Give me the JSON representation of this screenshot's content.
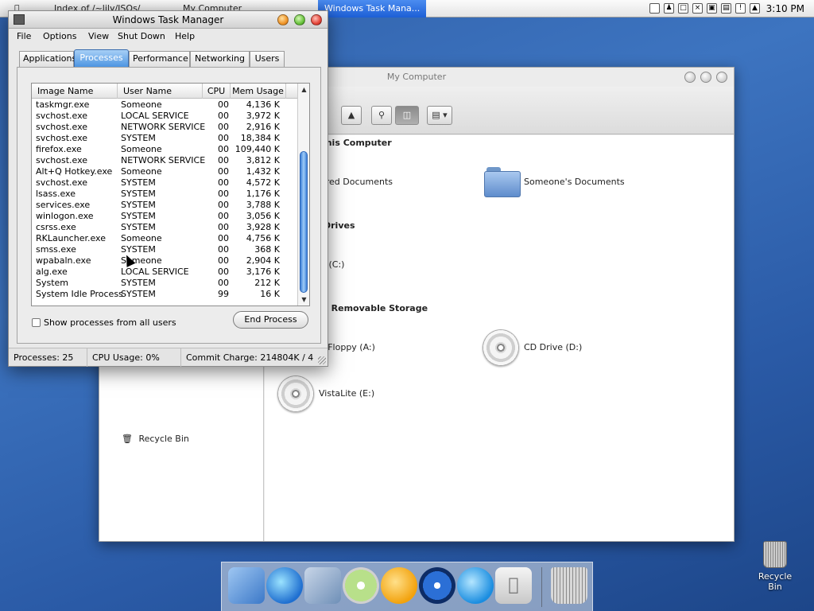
{
  "menubar": {
    "tasks": [
      "Index of /~lily/ISOs/",
      "My Computer"
    ],
    "active_task": "Windows Task Mana...",
    "clock": "3:10 PM"
  },
  "mycomputer": {
    "title": "My Computer",
    "sections": {
      "on_this_computer": "on This Computer",
      "drives": "Drives",
      "removable": "n Removable Storage"
    },
    "items": {
      "shared_docs": "ared Documents",
      "someones_docs": "Someone's Documents",
      "local_disk": "S (C:)",
      "floppy": "s Floppy (A:)",
      "cd_drive": "CD Drive (D:)",
      "vistalite": "VistaLite (E:)"
    },
    "sidebar_recycle": "Recycle Bin"
  },
  "taskmanager": {
    "title": "Windows Task Manager",
    "menu": [
      "File",
      "Options",
      "View",
      "Shut Down",
      "Help"
    ],
    "tabs": [
      "Applications",
      "Processes",
      "Performance",
      "Networking",
      "Users"
    ],
    "active_tab": "Processes",
    "columns": [
      "Image Name",
      "User Name",
      "CPU",
      "Mem Usage"
    ],
    "processes": [
      [
        "taskmgr.exe",
        "Someone",
        "00",
        "4,136 K"
      ],
      [
        "svchost.exe",
        "LOCAL SERVICE",
        "00",
        "3,972 K"
      ],
      [
        "svchost.exe",
        "NETWORK SERVICE",
        "00",
        "2,916 K"
      ],
      [
        "svchost.exe",
        "SYSTEM",
        "00",
        "18,384 K"
      ],
      [
        "firefox.exe",
        "Someone",
        "00",
        "109,440 K"
      ],
      [
        "svchost.exe",
        "NETWORK SERVICE",
        "00",
        "3,812 K"
      ],
      [
        "Alt+Q Hotkey.exe",
        "Someone",
        "00",
        "1,432 K"
      ],
      [
        "svchost.exe",
        "SYSTEM",
        "00",
        "4,572 K"
      ],
      [
        "lsass.exe",
        "SYSTEM",
        "00",
        "1,176 K"
      ],
      [
        "services.exe",
        "SYSTEM",
        "00",
        "3,788 K"
      ],
      [
        "winlogon.exe",
        "SYSTEM",
        "00",
        "3,056 K"
      ],
      [
        "csrss.exe",
        "SYSTEM",
        "00",
        "3,928 K"
      ],
      [
        "RKLauncher.exe",
        "Someone",
        "00",
        "4,756 K"
      ],
      [
        "smss.exe",
        "SYSTEM",
        "00",
        "368 K"
      ],
      [
        "wpabaln.exe",
        "Someone",
        "00",
        "2,904 K"
      ],
      [
        "alg.exe",
        "LOCAL SERVICE",
        "00",
        "3,176 K"
      ],
      [
        "System",
        "SYSTEM",
        "00",
        "212 K"
      ],
      [
        "System Idle Process",
        "SYSTEM",
        "99",
        "16 K"
      ]
    ],
    "show_all_label": "Show processes from all users",
    "show_all_checked": false,
    "end_process_label": "End Process",
    "status": {
      "processes": "Processes: 25",
      "cpu": "CPU Usage: 0%",
      "commit": "Commit Charge: 214804K / 4"
    }
  },
  "desktop": {
    "recycle_label": "Recycle Bin"
  },
  "colors": {
    "desktop": "#2f5fa8",
    "accent": "#4d95e2"
  }
}
